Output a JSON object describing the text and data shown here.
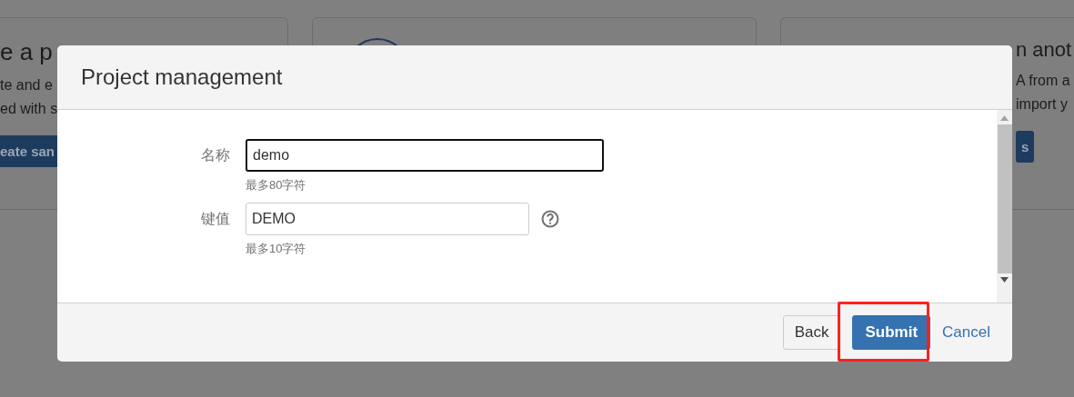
{
  "background_cards": [
    {
      "title": "e a p",
      "lines": [
        "te and e",
        "ed with s"
      ],
      "button": "eate san"
    },
    {
      "kind": "icon"
    },
    {
      "title": "n anot",
      "lines": [
        "A from a",
        "import y"
      ],
      "button": "s"
    }
  ],
  "dialog": {
    "title": "Project management",
    "fields": [
      {
        "label": "名称",
        "value": "demo",
        "hint": "最多80字符",
        "focused": true,
        "help": false
      },
      {
        "label": "键值",
        "value": "DEMO",
        "hint": "最多10字符",
        "focused": false,
        "help": true
      }
    ],
    "buttons": [
      {
        "label": "Back",
        "kind": "secondary"
      },
      {
        "label": "Submit",
        "kind": "primary"
      },
      {
        "label": "Cancel",
        "kind": "link"
      }
    ]
  }
}
